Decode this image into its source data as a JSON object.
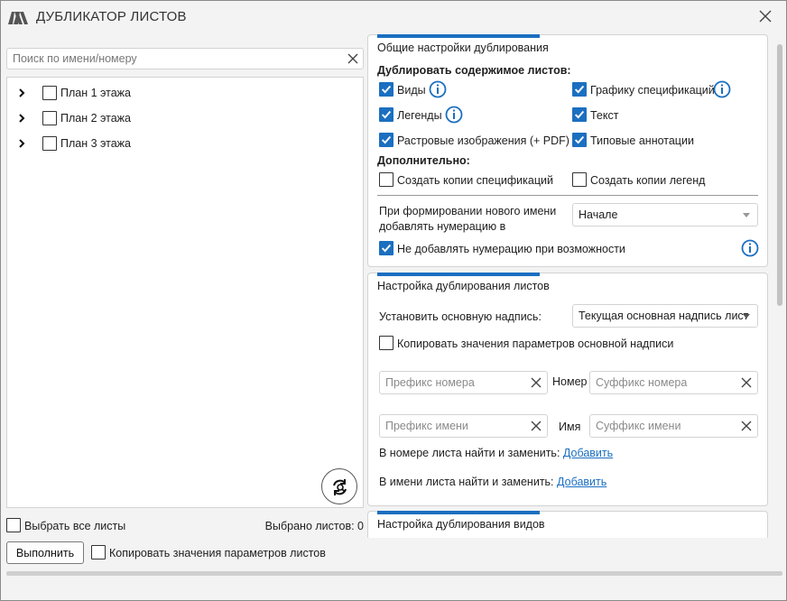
{
  "app": {
    "title": "ДУБЛИКАТОР ЛИСТОВ",
    "accent_color": "#1b6fc0"
  },
  "left": {
    "search_placeholder": "Поиск по имени/номеру",
    "search_value": "",
    "tree": [
      {
        "label": "План 1 этажа",
        "checked": false
      },
      {
        "label": "План 2 этажа",
        "checked": false
      },
      {
        "label": "План 3 этажа",
        "checked": false
      }
    ],
    "select_all_label": "Выбрать все листы",
    "selected_count": "Выбрано листов: 0",
    "run_label": "Выполнить",
    "copy_params_label": "Копировать значения параметров листов"
  },
  "general": {
    "title": "Общие настройки дублирования",
    "content_heading": "Дублировать содержимое листов:",
    "views": "Виды",
    "spec_graphics": "Графику спецификаций",
    "legends": "Легенды",
    "text": "Текст",
    "raster": "Растровые изображения (+ PDF)",
    "typical_annotations": "Типовые аннотации",
    "extra_heading": "Дополнительно:",
    "copy_specs": "Создать копии спецификаций",
    "copy_legends": "Создать копии легенд",
    "numbering_label_1": "При формировании нового имени",
    "numbering_label_2": "добавлять нумерацию в",
    "numbering_value": "Начале",
    "no_numbering": "Не добавлять нумерацию при возможности"
  },
  "sheets": {
    "title": "Настройка дублирования листов",
    "titleblock_label": "Установить основную надпись:",
    "titleblock_value": "Текущая основная надпись лист",
    "copy_titleblock_params": "Копировать значения параметров основной надписи",
    "number_prefix_placeholder": "Префикс номера",
    "number_label": "Номер",
    "number_suffix_placeholder": "Суффикс номера",
    "name_prefix_placeholder": "Префикс имени",
    "name_label": "Имя",
    "name_suffix_placeholder": "Суффикс имени",
    "find_replace_number": "В номере листа найти и заменить:",
    "find_replace_name": "В имени листа найти и заменить:",
    "add_link": "Добавить"
  },
  "views_panel": {
    "title": "Настройка дублирования видов"
  }
}
